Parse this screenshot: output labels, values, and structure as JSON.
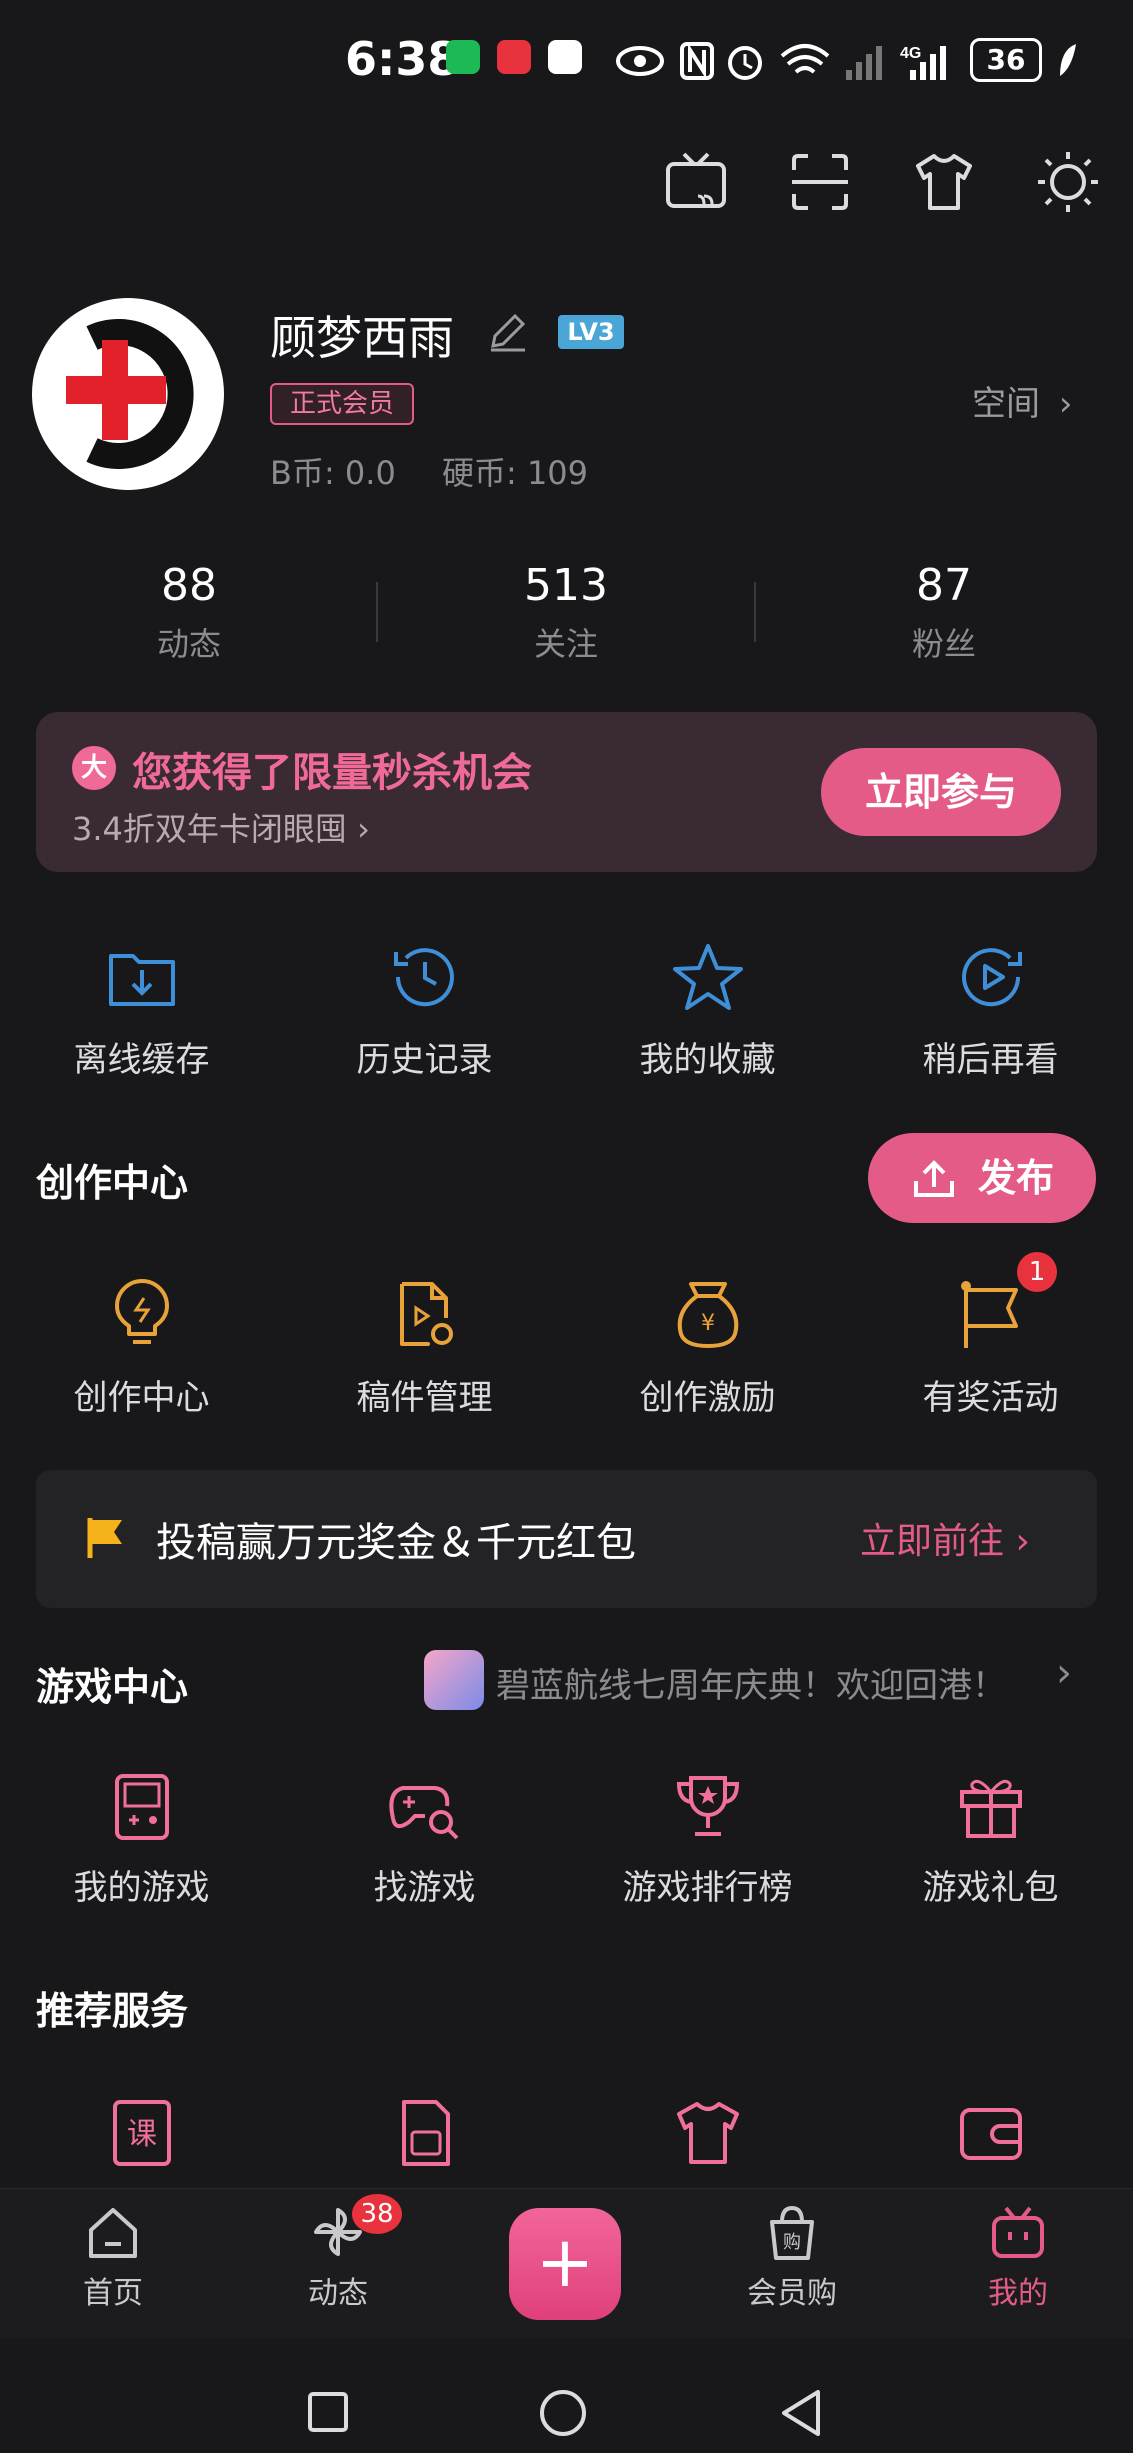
{
  "status_bar": {
    "time": "6:38",
    "battery": "36",
    "network": "4G"
  },
  "profile": {
    "username": "顾梦西雨",
    "level_badge": "LV3",
    "membership": "正式会员",
    "b_coins": "B币: 0.0",
    "coins": "硬币: 109",
    "space_link": "空间"
  },
  "stats": [
    {
      "value": "88",
      "label": "动态"
    },
    {
      "value": "513",
      "label": "关注"
    },
    {
      "value": "87",
      "label": "粉丝"
    }
  ],
  "promo": {
    "badge": "大",
    "title": "您获得了限量秒杀机会",
    "subtitle": "3.4折双年卡闭眼囤",
    "button": "立即参与"
  },
  "quick_actions": [
    {
      "label": "离线缓存",
      "icon": "download-folder-icon"
    },
    {
      "label": "历史记录",
      "icon": "history-clock-icon"
    },
    {
      "label": "我的收藏",
      "icon": "star-icon"
    },
    {
      "label": "稍后再看",
      "icon": "watch-later-icon"
    }
  ],
  "creation_center": {
    "title": "创作中心",
    "publish_button": "发布",
    "items": [
      {
        "label": "创作中心",
        "icon": "lightbulb-icon"
      },
      {
        "label": "稿件管理",
        "icon": "manuscript-icon"
      },
      {
        "label": "创作激励",
        "icon": "money-bag-icon"
      },
      {
        "label": "有奖活动",
        "icon": "flag-icon",
        "badge": "1"
      }
    ],
    "contest_banner": {
      "text": "投稿赢万元奖金＆千元红包",
      "link": "立即前往"
    }
  },
  "game_center": {
    "title": "游戏中心",
    "banner_text": "碧蓝航线七周年庆典！欢迎回港！",
    "items": [
      {
        "label": "我的游戏",
        "icon": "gameboy-icon"
      },
      {
        "label": "找游戏",
        "icon": "gamepad-search-icon"
      },
      {
        "label": "游戏排行榜",
        "icon": "trophy-icon"
      },
      {
        "label": "游戏礼包",
        "icon": "gift-icon"
      }
    ]
  },
  "recommended_services": {
    "title": "推荐服务",
    "items": [
      {
        "icon": "course-book-icon"
      },
      {
        "icon": "sim-card-icon"
      },
      {
        "icon": "tshirt-icon"
      },
      {
        "icon": "wallet-icon"
      }
    ]
  },
  "bottom_nav": [
    {
      "label": "首页",
      "icon": "home-icon"
    },
    {
      "label": "动态",
      "icon": "pinwheel-icon",
      "badge": "38"
    },
    {
      "label": "",
      "icon": "plus-icon"
    },
    {
      "label": "会员购",
      "icon": "shopping-bag-icon"
    },
    {
      "label": "我的",
      "icon": "tv-mascot-icon"
    }
  ],
  "colors": {
    "accent": "#e35b86",
    "background": "#18181a",
    "blue": "#3f8fd8",
    "gold": "#e8a23a"
  }
}
